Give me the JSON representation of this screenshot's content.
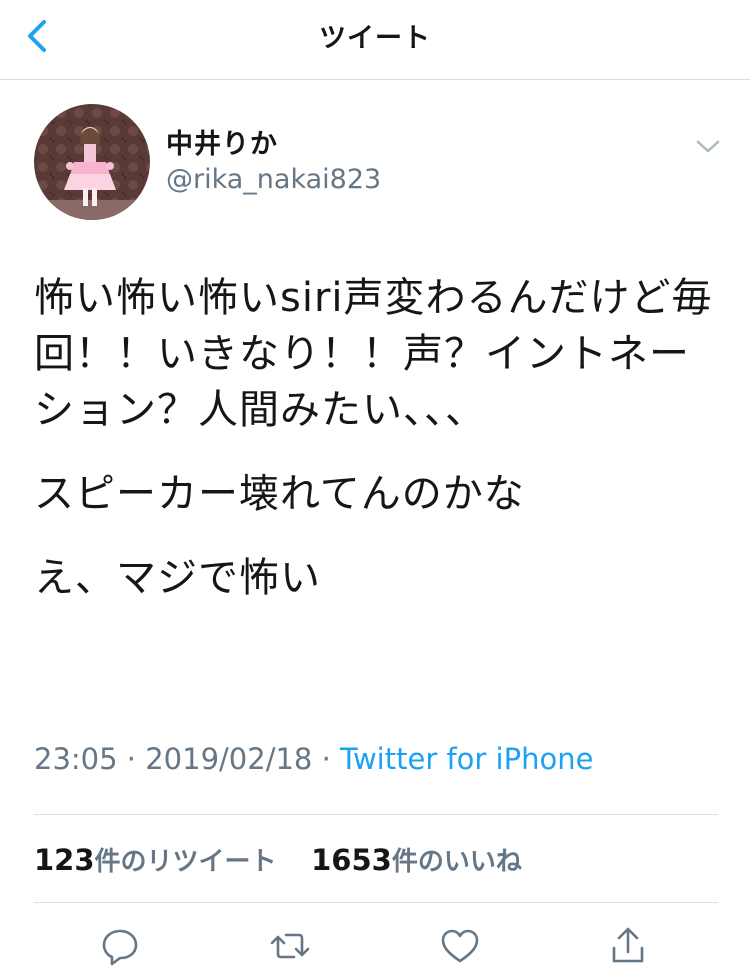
{
  "header": {
    "title": "ツイート",
    "back_icon": "chevron-left-icon",
    "accent_color": "#1da1f2"
  },
  "author": {
    "name": "中井りか",
    "handle": "@rika_nakai823"
  },
  "tweet": {
    "paragraphs": [
      "怖い怖い怖いsiri声変わるんだけど毎回！！いきなり！！声？イントネーション？人間みたい、、、",
      "スピーカー壊れてんのかな",
      "え、マジで怖い"
    ]
  },
  "meta": {
    "time": "23:05",
    "separator": " · ",
    "date": "2019/02/18",
    "source": "Twitter for iPhone"
  },
  "stats": {
    "retweets_count": "123",
    "retweets_label": "件のリツイート",
    "likes_count": "1653",
    "likes_label": "件のいいね"
  },
  "actions": {
    "reply_icon": "reply-icon",
    "retweet_icon": "retweet-icon",
    "like_icon": "heart-icon",
    "share_icon": "share-icon"
  },
  "colors": {
    "text": "#14171a",
    "secondary": "#657786",
    "link": "#1da1f2",
    "divider": "#d8dde2"
  }
}
